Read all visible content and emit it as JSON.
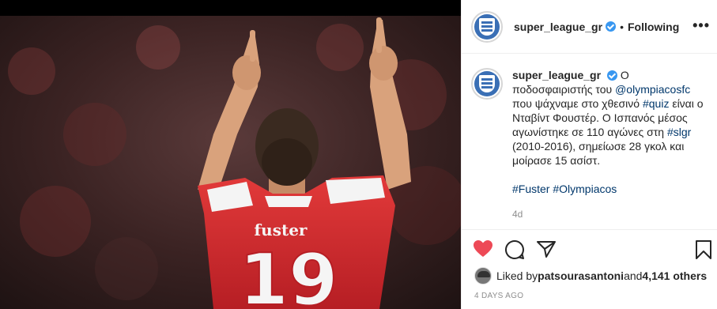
{
  "post": {
    "player_name_on_shirt": "fuster",
    "player_number_on_shirt": "19"
  },
  "header": {
    "username": "super_league_gr",
    "separator": "•",
    "follow_status": "Following",
    "more_label": "•••"
  },
  "caption": {
    "username": "super_league_gr",
    "text_1": "Ο ποδοσφαιριστής του ",
    "mention": "@olympiacosfc",
    "text_2": " που ψάχναμε στο χθεσινό ",
    "hashtag_quiz": "#quiz",
    "text_3": " είναι ο Νταβίντ Φουστέρ. Ο Ισπανός μέσος αγωνίστηκε σε 110 αγώνες στη ",
    "hashtag_slgr": "#slgr",
    "text_4": " (2010-2016), σημείωσε 28 γκολ και μοίρασε 15 ασίστ.",
    "hashtag_fuster": "#Fuster",
    "hashtag_olympiacos": "#Olympiacos",
    "age": "4d"
  },
  "likes": {
    "prefix": "Liked by ",
    "user": "patsourasantoni",
    "middle": " and ",
    "count": "4,141 others"
  },
  "timestamp": "4 DAYS AGO",
  "icons": [
    "heart-icon",
    "comment-icon",
    "share-icon",
    "bookmark-icon",
    "verified-badge-icon",
    "more-options-icon"
  ],
  "colors": {
    "like_red": "#ed4956",
    "link_blue": "#00376b",
    "verified_blue": "#3897f0",
    "shirt_red": "#d8282f"
  }
}
